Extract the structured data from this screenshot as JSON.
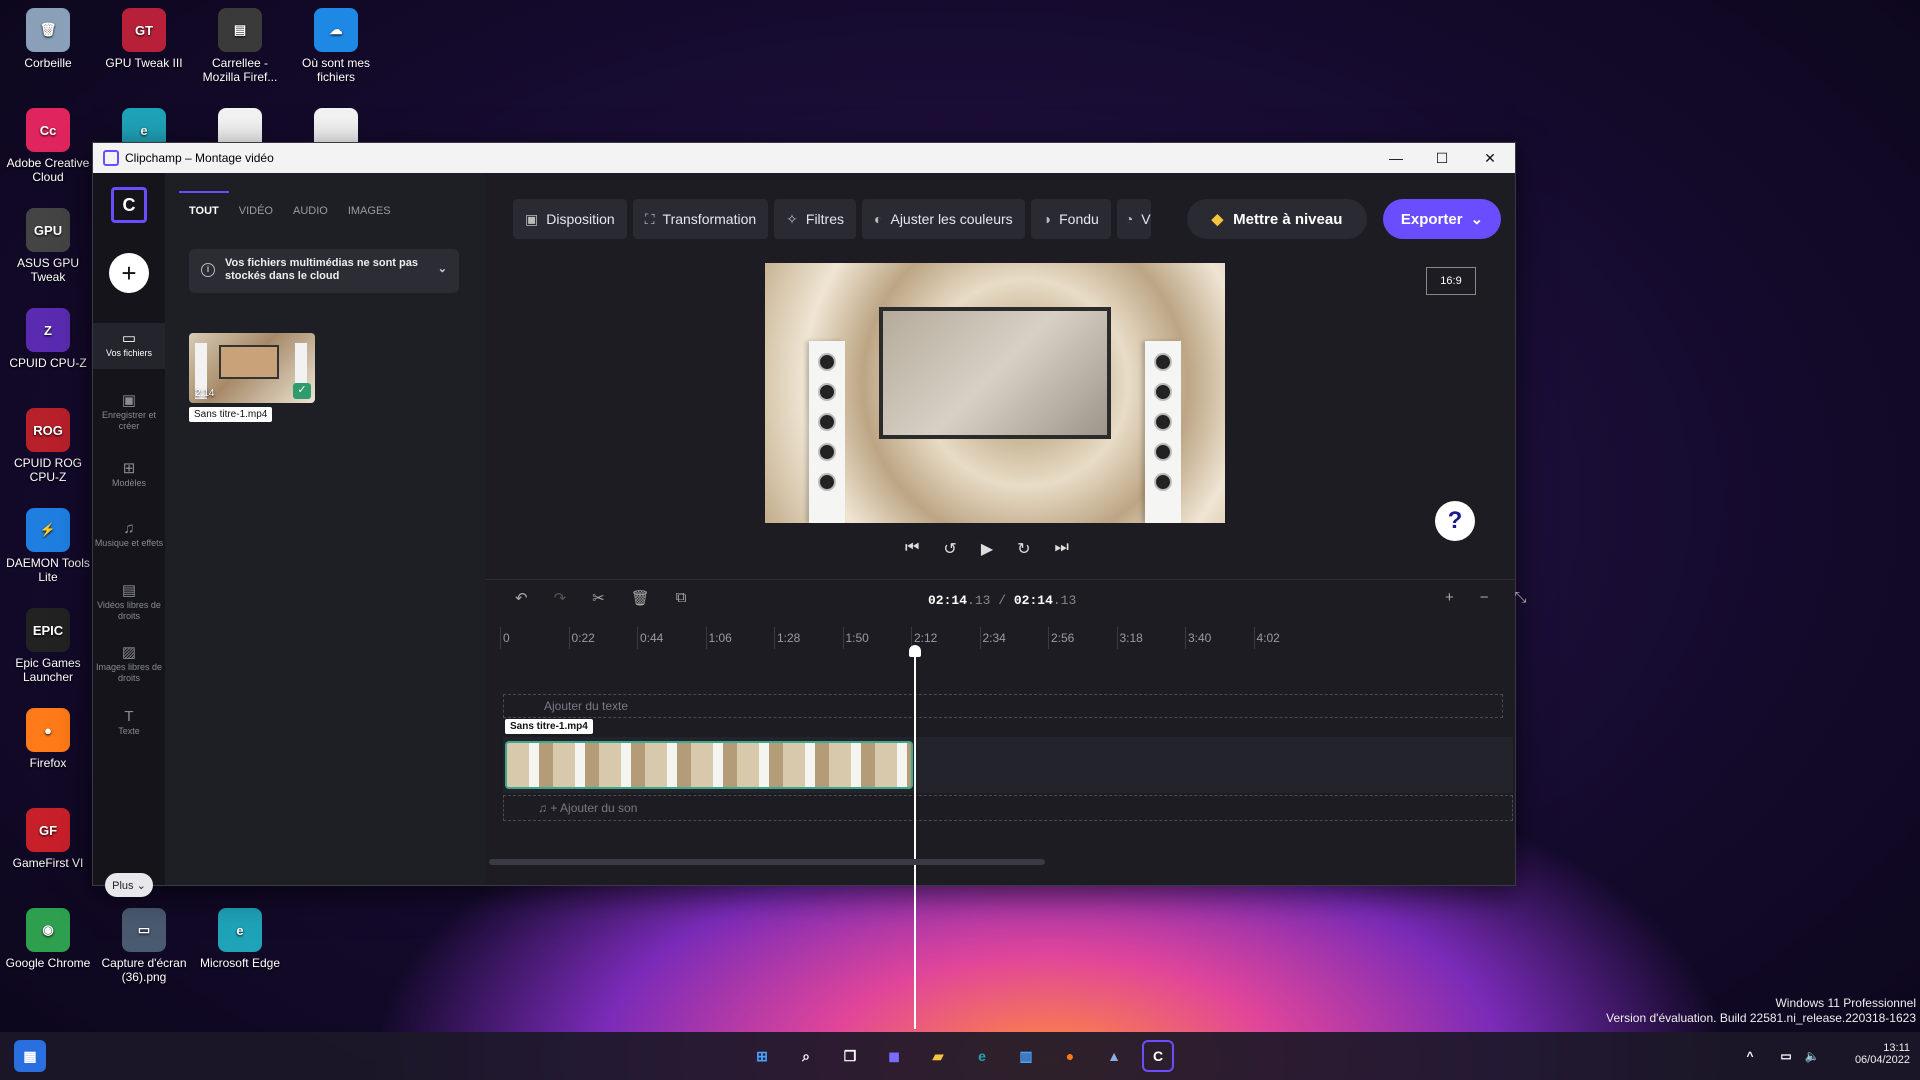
{
  "desktop": {
    "icons": [
      {
        "label": "Corbeille",
        "icon": "recycle-bin-icon",
        "color": "#8aa0b8",
        "glyph": "🗑"
      },
      {
        "label": "GPU Tweak III",
        "icon": "gpu-tweak-icon",
        "color": "#b8203a",
        "glyph": "GT"
      },
      {
        "label": "Carrellee - Mozilla Firef...",
        "icon": "firefox-file-icon",
        "color": "#3a3a3a",
        "glyph": "▤"
      },
      {
        "label": "Où sont mes fichiers",
        "icon": "onedrive-icon",
        "color": "#1e88e5",
        "glyph": "☁"
      },
      {
        "label": "Adobe Creative Cloud",
        "icon": "adobe-cc-icon",
        "color": "#e0245e",
        "glyph": "Cc"
      },
      {
        "label": "",
        "icon": "edge-icon",
        "color": "#1fa3b8",
        "glyph": "e"
      },
      {
        "label": "",
        "icon": "document-icon",
        "color": "#f2f2f2",
        "glyph": ""
      },
      {
        "label": "",
        "icon": "document-icon",
        "color": "#f2f2f2",
        "glyph": ""
      },
      {
        "label": "ASUS GPU Tweak",
        "icon": "asus-gpu-icon",
        "color": "#444",
        "glyph": "GPU"
      },
      {
        "label": "CPUID CPU-Z",
        "icon": "cpuz-icon",
        "color": "#5a2bb0",
        "glyph": "Z"
      },
      {
        "label": "CPUID ROG CPU-Z",
        "icon": "rog-cpuz-icon",
        "color": "#b8202a",
        "glyph": "ROG"
      },
      {
        "label": "DAEMON Tools Lite",
        "icon": "daemon-tools-icon",
        "color": "#1e7fe0",
        "glyph": "⚡"
      },
      {
        "label": "Epic Games Launcher",
        "icon": "epic-games-icon",
        "color": "#222",
        "glyph": "EPIC"
      },
      {
        "label": "Firefox",
        "icon": "firefox-icon",
        "color": "#ff7a18",
        "glyph": "●"
      },
      {
        "label": "GameFirst VI",
        "icon": "gamefirst-icon",
        "color": "#c8202a",
        "glyph": "GF"
      },
      {
        "label": "Google Chrome",
        "icon": "chrome-icon",
        "color": "#2e9e4f",
        "glyph": "◉"
      },
      {
        "label": "Capture d'écran (36).png",
        "icon": "image-file-icon",
        "color": "#4a5a70",
        "glyph": "▭"
      },
      {
        "label": "Microsoft Edge",
        "icon": "edge-icon",
        "color": "#1fa3b8",
        "glyph": "e"
      }
    ]
  },
  "window": {
    "title": "Clipchamp – Montage vidéo",
    "minimize": "—",
    "maximize": "☐",
    "close": "✕"
  },
  "rail": {
    "logo": "C",
    "add": "+",
    "items": [
      {
        "label": "Vos fichiers",
        "icon": "folder-icon",
        "glyph": "▭"
      },
      {
        "label": "Enregistrer et créer",
        "icon": "record-icon",
        "glyph": "▣"
      },
      {
        "label": "Modèles",
        "icon": "templates-icon",
        "glyph": "⊞"
      },
      {
        "label": "Musique et effets",
        "icon": "music-icon",
        "glyph": "♫"
      },
      {
        "label": "Vidéos libres de droits",
        "icon": "stock-video-icon",
        "glyph": "▤"
      },
      {
        "label": "Images libres de droits",
        "icon": "stock-image-icon",
        "glyph": "▨"
      },
      {
        "label": "Texte",
        "icon": "text-icon",
        "glyph": "T"
      }
    ],
    "plus": "Plus ⌄"
  },
  "media": {
    "tabs": [
      "TOUT",
      "VIDÉO",
      "AUDIO",
      "IMAGES"
    ],
    "notice": "Vos fichiers multimédias ne sont pas stockés dans le cloud",
    "thumb_duration": "2:14",
    "file_name": "Sans titre-1.mp4"
  },
  "toolbar": {
    "buttons": [
      {
        "label": "Disposition",
        "icon": "layout-icon",
        "glyph": "▣"
      },
      {
        "label": "Transformation",
        "icon": "transform-icon",
        "glyph": "⛶"
      },
      {
        "label": "Filtres",
        "icon": "filters-icon",
        "glyph": "✧"
      },
      {
        "label": "Ajuster les couleurs",
        "icon": "color-adjust-icon",
        "glyph": "◐"
      },
      {
        "label": "Fondu",
        "icon": "fade-icon",
        "glyph": "◑"
      },
      {
        "label": "V",
        "icon": "speed-icon",
        "glyph": "◔"
      }
    ],
    "upgrade": "Mettre à niveau",
    "export": "Exporter"
  },
  "preview": {
    "ratio": "16:9",
    "help": "?"
  },
  "timeline": {
    "current": "02:14",
    "current_frames": ".13",
    "separator": "/",
    "total": "02:14",
    "total_frames": ".13",
    "ruler": [
      "0",
      "0:22",
      "0:44",
      "1:06",
      "1:28",
      "1:50",
      "2:12",
      "2:34",
      "2:56",
      "3:18",
      "3:40",
      "4:02"
    ],
    "text_track": "Ajouter du texte",
    "clip_name": "Sans titre-1.mp4",
    "audio_track": "+ Ajouter du son"
  },
  "taskbar": {
    "clock_time": "13:11",
    "clock_date": "06/04/2022"
  },
  "watermark": {
    "line1": "Windows 11 Professionnel",
    "line2": "Version d'évaluation. Build 22581.ni_release.220318-1623"
  }
}
